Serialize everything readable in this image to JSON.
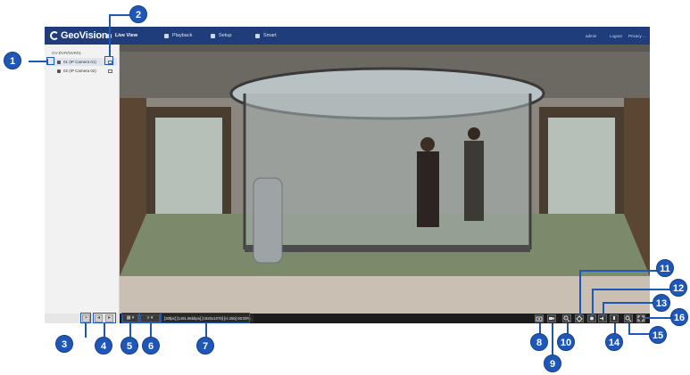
{
  "app": {
    "brand": "GeoVision",
    "nav": [
      {
        "label": "Live View",
        "active": true
      },
      {
        "label": "Playback"
      },
      {
        "label": "Setup"
      },
      {
        "label": "Smart"
      }
    ],
    "topright": [
      "admin",
      "Logout",
      "Privacy ..."
    ]
  },
  "sidebar": {
    "tree_root": "GV-DVR/NVR01",
    "cameras": [
      {
        "label": "01 (IP Camera 01)",
        "selected": true
      },
      {
        "label": "02 (IP Camera 02)",
        "selected": false
      }
    ],
    "bottom_buttons": [
      "▪",
      "◂",
      "▸"
    ]
  },
  "toolbar": {
    "layout_label": "▦ ▾",
    "stream_label": "≡ ▾",
    "info": "[30fps] [1491.96kbps] [1920x1076] [H.265] 00:00%",
    "icons": [
      "snapshot",
      "record",
      "zoom",
      "ptz",
      "audio-in",
      "audio-out",
      "speaker",
      "microphone",
      "search",
      "fullscreen"
    ]
  },
  "callouts": [
    "1",
    "2",
    "3",
    "4",
    "5",
    "6",
    "7",
    "8",
    "9",
    "10",
    "11",
    "12",
    "13",
    "14",
    "15",
    "16"
  ],
  "colors": {
    "accent": "#1e57b8",
    "header": "#1f3d7a",
    "toolbar": "#1c1c1c"
  }
}
